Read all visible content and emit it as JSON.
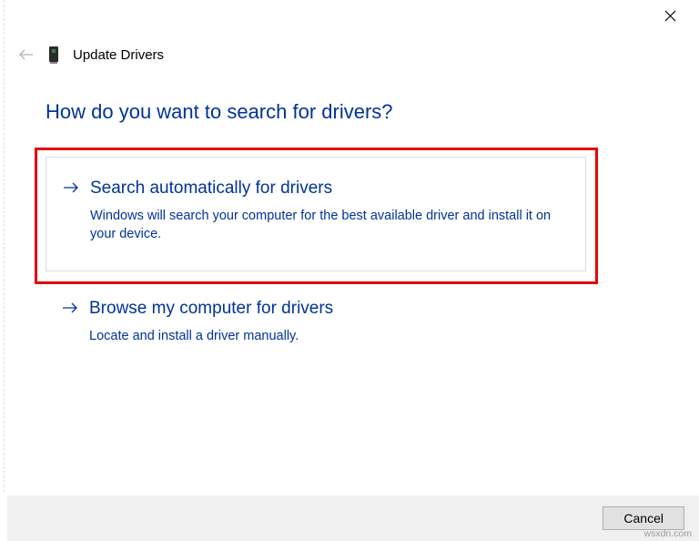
{
  "header": {
    "title": "Update Drivers"
  },
  "question": "How do you want to search for drivers?",
  "options": {
    "search": {
      "title": "Search automatically for drivers",
      "desc": "Windows will search your computer for the best available driver and install it on your device."
    },
    "browse": {
      "title": "Browse my computer for drivers",
      "desc": "Locate and install a driver manually."
    }
  },
  "footer": {
    "cancel": "Cancel"
  },
  "watermark": "wsxdn.com"
}
